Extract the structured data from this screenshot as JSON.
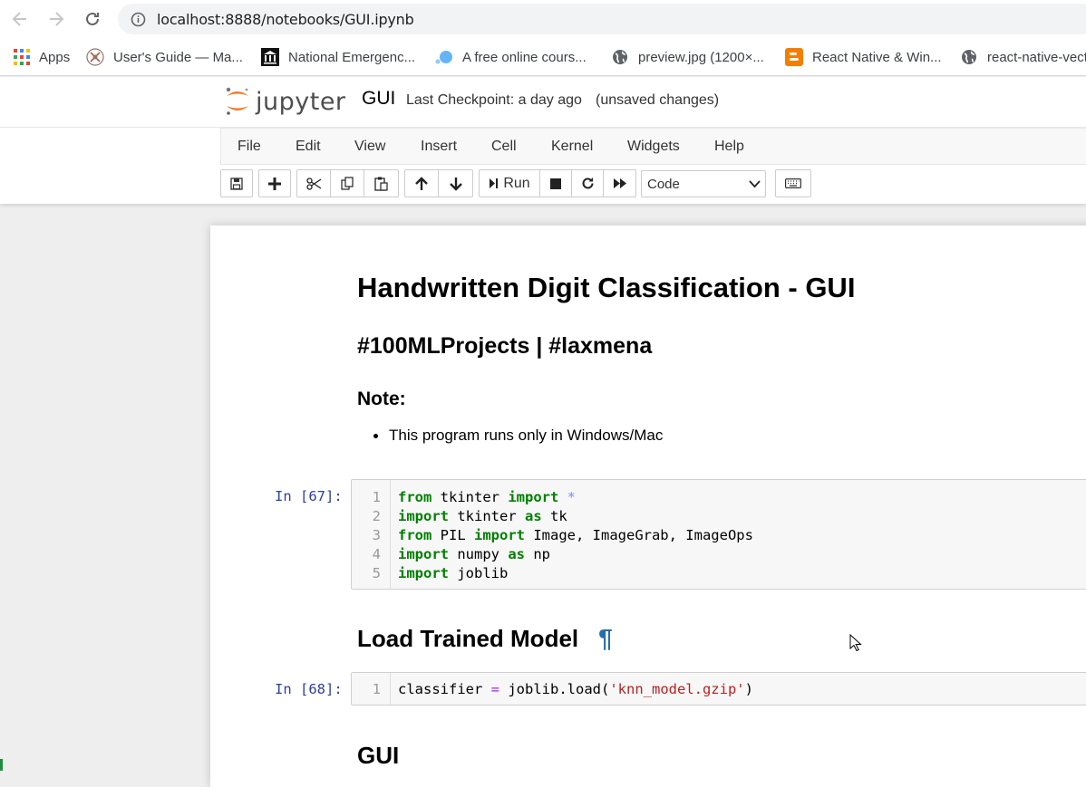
{
  "browser": {
    "url": "localhost:8888/notebooks/GUI.ipynb",
    "bookmarks": [
      {
        "label": "Apps",
        "icon": "apps-grid-icon"
      },
      {
        "label": "User's Guide — Ma...",
        "icon": "compass-icon"
      },
      {
        "label": "National Emergenc...",
        "icon": "building-icon"
      },
      {
        "label": "A free online cours...",
        "icon": "blue-dots-icon"
      },
      {
        "label": "preview.jpg (1200×...",
        "icon": "globe-icon"
      },
      {
        "label": "React Native & Win...",
        "icon": "blogger-icon"
      },
      {
        "label": "react-native-vect",
        "icon": "globe-icon"
      }
    ]
  },
  "jupyter": {
    "logo_text": "jupyter",
    "notebook_name": "GUI",
    "checkpoint": "Last Checkpoint: a day ago",
    "status": "(unsaved changes)",
    "menu": [
      "File",
      "Edit",
      "View",
      "Insert",
      "Cell",
      "Kernel",
      "Widgets",
      "Help"
    ],
    "toolbar": {
      "run_label": "Run",
      "cell_type": "Code",
      "cell_type_options": [
        "Code"
      ]
    }
  },
  "notebook": {
    "title": "Handwritten Digit Classification - GUI",
    "subtitle": "#100MLProjects | #laxmena",
    "note_heading": "Note:",
    "note_bullet": "This program runs only in Windows/Mac",
    "cell1": {
      "prompt": "In [67]:",
      "lines": [
        "from tkinter import *",
        "import tkinter as tk",
        "from PIL import Image, ImageGrab, ImageOps",
        "import numpy as np",
        "import joblib"
      ]
    },
    "section2_heading": "Load Trained Model",
    "anchor_symbol": "¶",
    "cell2": {
      "prompt": "In [68]:",
      "lines": [
        "classifier = joblib.load('knn_model.gzip')"
      ]
    },
    "section3_heading": "GUI"
  },
  "colors": {
    "prompt": "#303f9f",
    "keyword": "#008000",
    "string": "#ba2121",
    "operator": "#aa22ff",
    "jupyter_orange": "#f37726",
    "anchor": "#296eaa"
  }
}
